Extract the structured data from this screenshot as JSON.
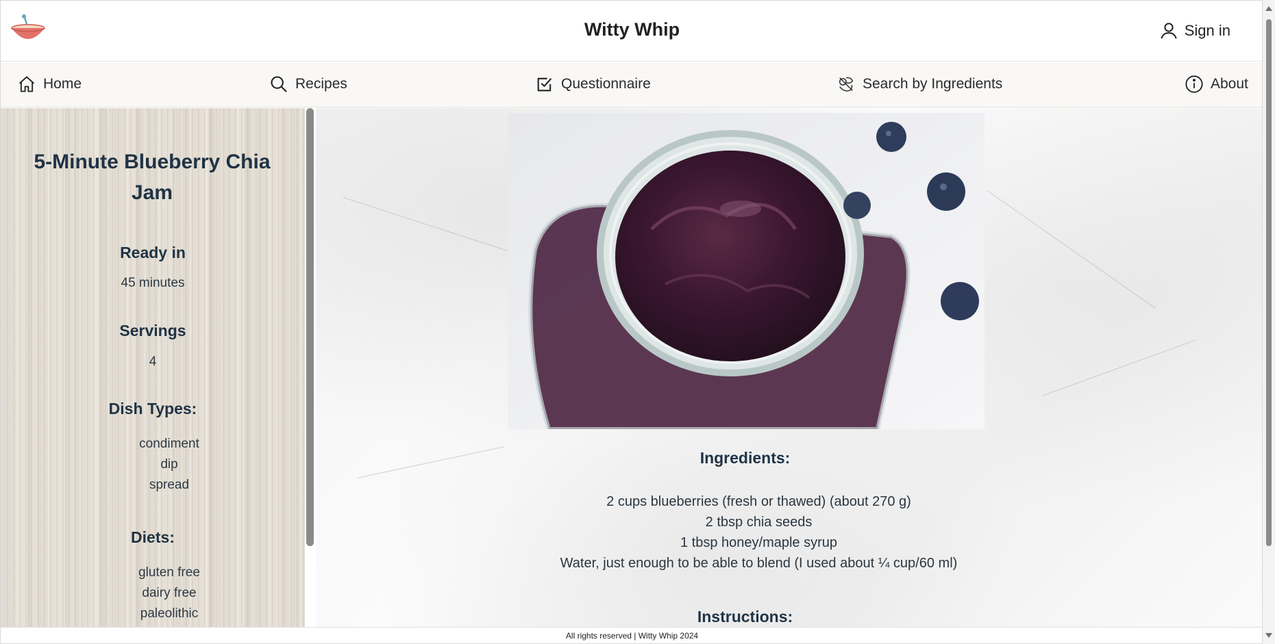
{
  "header": {
    "brand": "Witty Whip",
    "signin_label": "Sign in",
    "logo_icon": "bowl-logo-icon",
    "accent_color": "#e2726a"
  },
  "nav": {
    "items": [
      {
        "label": "Home",
        "icon": "home-icon"
      },
      {
        "label": "Recipes",
        "icon": "search-icon"
      },
      {
        "label": "Questionnaire",
        "icon": "checkbox-icon"
      },
      {
        "label": "Search by Ingredients",
        "icon": "ingredients-icon"
      },
      {
        "label": "About",
        "icon": "info-icon"
      }
    ]
  },
  "sidebar": {
    "title": "5-Minute Blueberry Chia Jam",
    "ready_heading": "Ready in",
    "ready_value": "45 minutes",
    "servings_heading": "Servings",
    "servings_value": "4",
    "dish_types_heading": "Dish Types:",
    "dish_types": [
      "condiment",
      "dip",
      "spread"
    ],
    "diets_heading": "Diets:",
    "diets": [
      "gluten free",
      "dairy free",
      "paleolithic"
    ]
  },
  "main": {
    "image_alt": "blueberry chia jam in glass jar",
    "ingredients_heading": "Ingredients:",
    "ingredients": [
      "2 cups blueberries (fresh or thawed) (about 270 g)",
      "2 tbsp chia seeds",
      "1 tbsp honey/maple syrup",
      "Water, just enough to be able to blend (I used about ¼ cup/60 ml)"
    ],
    "instructions_heading": "Instructions:"
  },
  "footer": {
    "text": "All rights reserved | Witty Whip 2024"
  }
}
